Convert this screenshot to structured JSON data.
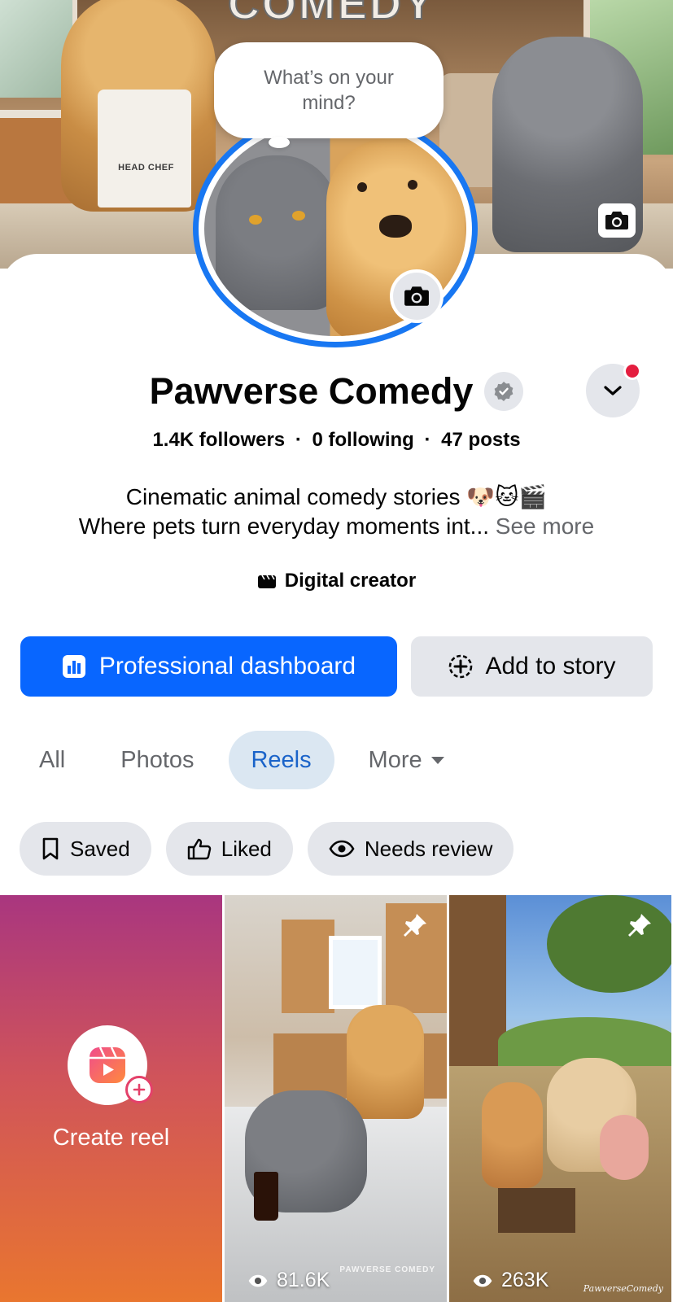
{
  "cover": {
    "title_text": "COMEDY",
    "apron_text": "HEAD CHEF",
    "camera_icon": "camera-icon"
  },
  "composer": {
    "prompt": "What’s on your mind?"
  },
  "profile": {
    "name": "Pawverse Comedy",
    "verified_icon": "verified-badge-icon",
    "followers": "1.4K followers",
    "following": "0 following",
    "posts": "47 posts",
    "separator": "·",
    "bio_line1": "Cinematic animal comedy stories 🐶🐱🎬",
    "bio_line2": "Where pets turn everyday moments int...",
    "see_more": "See more",
    "category": "Digital creator"
  },
  "actions": {
    "primary_label": "Professional dashboard",
    "secondary_label": "Add to story"
  },
  "tabs": [
    {
      "label": "All",
      "active": false
    },
    {
      "label": "Photos",
      "active": false
    },
    {
      "label": "Reels",
      "active": true
    },
    {
      "label": "More",
      "active": false
    }
  ],
  "filters": [
    {
      "label": "Saved",
      "icon": "bookmark-icon"
    },
    {
      "label": "Liked",
      "icon": "thumbs-up-icon"
    },
    {
      "label": "Needs review",
      "icon": "eye-icon"
    }
  ],
  "grid": {
    "create_label": "Create reel",
    "items": [
      {
        "views": "81.6K",
        "pinned": true,
        "watermark": "PAWVERSE COMEDY"
      },
      {
        "views": "263K",
        "pinned": true,
        "watermark": "PawverseComedy"
      }
    ]
  },
  "colors": {
    "accent": "#0866ff",
    "ring": "#1877f2",
    "chip_bg": "#e4e6eb",
    "active_tab_bg": "#dbe7f2",
    "active_tab_text": "#1a63c9",
    "notification": "#e41e3f"
  }
}
